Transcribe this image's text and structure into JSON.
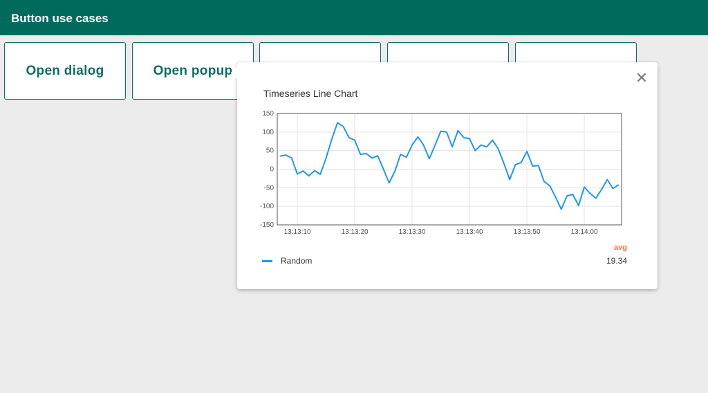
{
  "header": {
    "title": "Button use cases"
  },
  "buttons": [
    {
      "label": "Open dialog"
    },
    {
      "label": "Open popup"
    },
    {
      "label": ""
    },
    {
      "label": ""
    },
    {
      "label": ""
    }
  ],
  "popup": {
    "close_icon": "close-icon"
  },
  "colors": {
    "primary": "#006b5d",
    "series": "#2196f3",
    "avg_label": "#ff7043"
  },
  "chart_data": {
    "type": "line",
    "title": "Timeseries Line Chart",
    "xlabel": "",
    "ylabel": "",
    "ylim": [
      -150,
      150
    ],
    "y_ticks": [
      150,
      100,
      50,
      0,
      -50,
      -100,
      -150
    ],
    "x_ticks": [
      "13:13:10",
      "13:13:20",
      "13:13:30",
      "13:13:40",
      "13:13:50",
      "13:14:00"
    ],
    "x_tick_seconds": [
      10,
      20,
      30,
      40,
      50,
      60
    ],
    "xlim_seconds": [
      6.5,
      66.5
    ],
    "grid": true,
    "legend_position": "bottom",
    "series": [
      {
        "name": "Random",
        "color": "#2196f3",
        "avg": "19.34",
        "x_seconds": [
          7,
          8,
          9,
          10,
          11,
          12,
          13,
          14,
          15,
          16,
          17,
          18,
          19,
          20,
          21,
          22,
          23,
          24,
          25,
          26,
          27,
          28,
          29,
          30,
          31,
          32,
          33,
          34,
          35,
          36,
          37,
          38,
          39,
          40,
          41,
          42,
          43,
          44,
          45,
          46,
          47,
          48,
          49,
          50,
          51,
          52,
          53,
          54,
          55,
          56,
          57,
          58,
          59,
          60,
          61,
          62,
          63,
          64,
          65,
          66
        ],
        "values": [
          35,
          38,
          30,
          -13,
          -5,
          -18,
          -4,
          -14,
          30,
          80,
          125,
          115,
          85,
          78,
          40,
          42,
          30,
          36,
          0,
          -37,
          -5,
          40,
          32,
          65,
          87,
          65,
          28,
          65,
          102,
          100,
          60,
          104,
          85,
          82,
          50,
          65,
          60,
          78,
          55,
          15,
          -28,
          12,
          18,
          48,
          8,
          10,
          -33,
          -45,
          -75,
          -108,
          -72,
          -68,
          -98,
          -48,
          -65,
          -78,
          -55,
          -28,
          -52,
          -42
        ]
      }
    ]
  },
  "legend": {
    "header": "avg"
  }
}
